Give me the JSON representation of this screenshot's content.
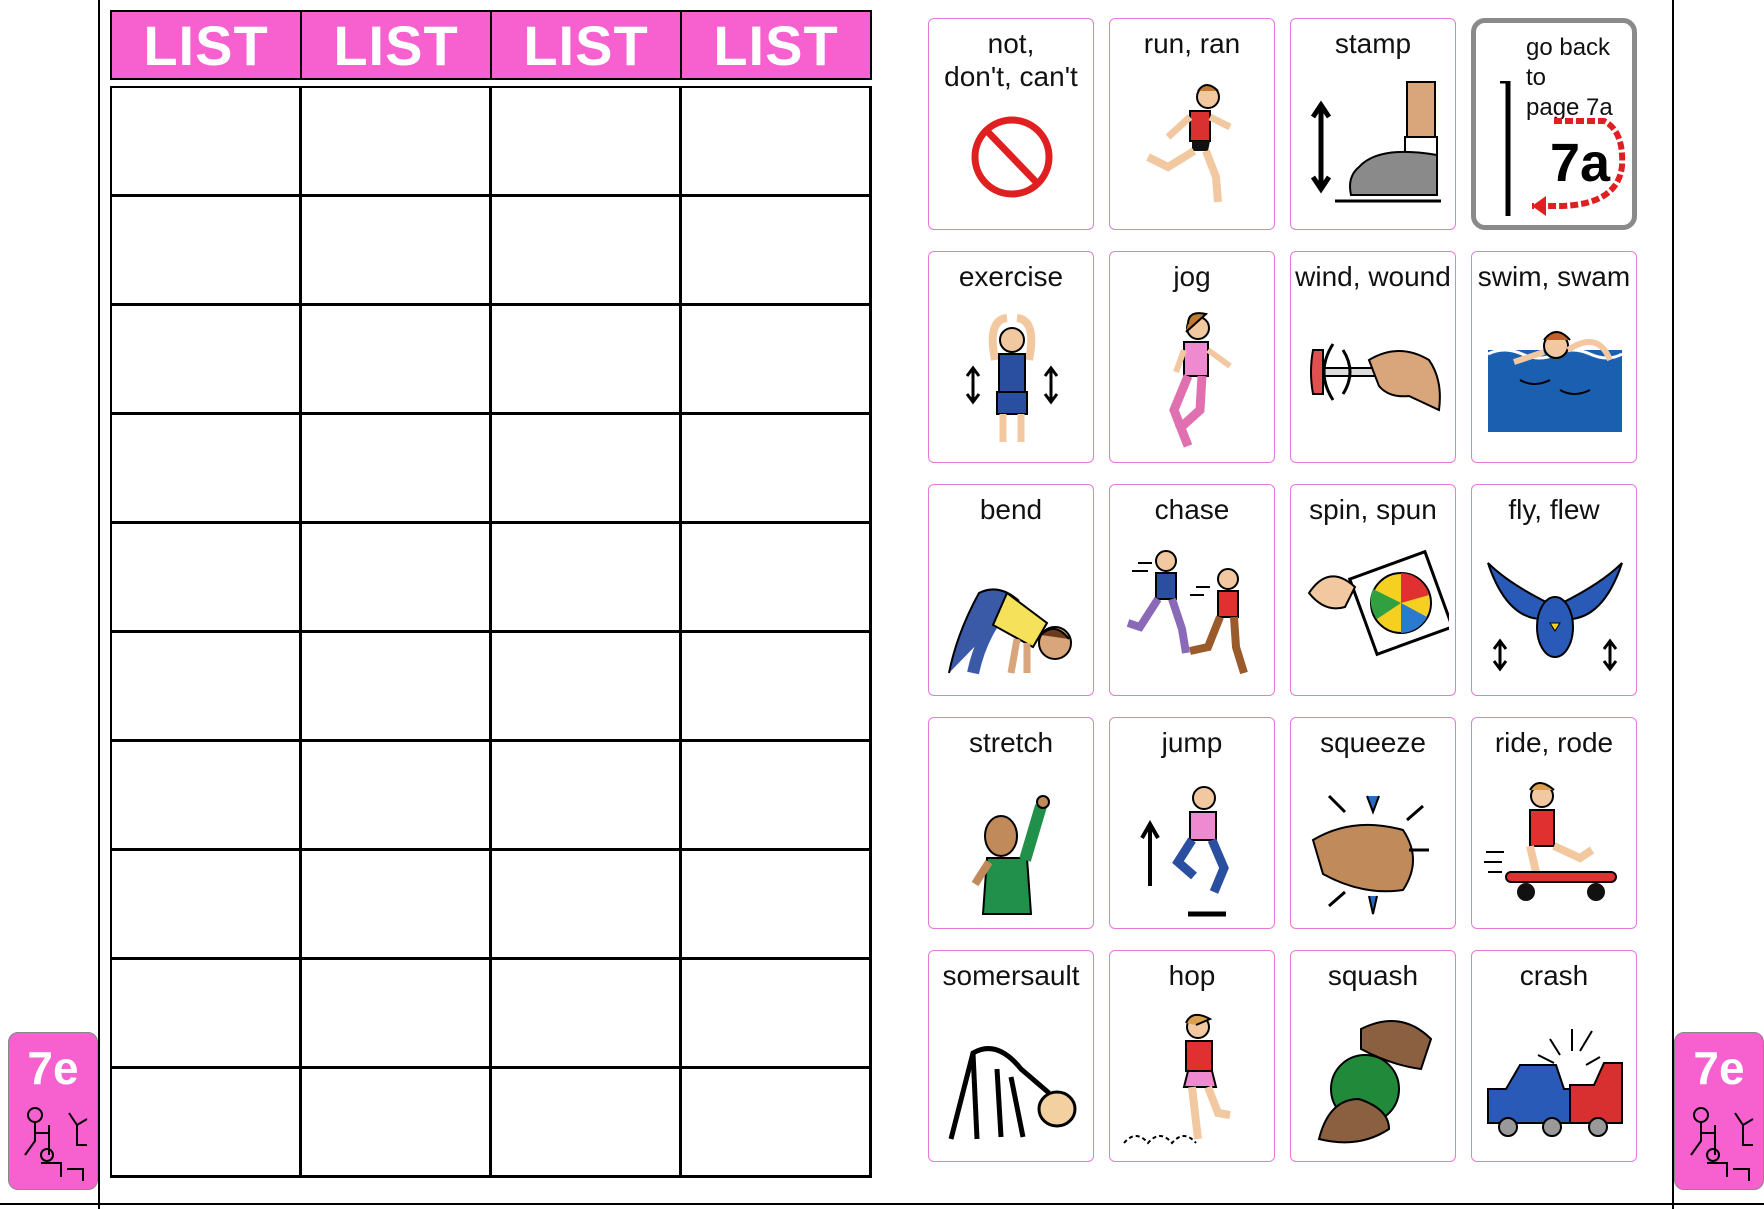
{
  "list_header": [
    "LIST",
    "LIST",
    "LIST",
    "LIST"
  ],
  "list_rows": 10,
  "tiles": [
    {
      "label": "not,\ndon't, can't",
      "icon": "prohibited-icon"
    },
    {
      "label": "run,  ran",
      "icon": "running-girl-icon"
    },
    {
      "label": "stamp",
      "icon": "stamping-foot-icon"
    },
    {
      "label": "go back to\npage 7a",
      "icon": "go-back-page-7a-icon",
      "sub": "7a"
    },
    {
      "label": "exercise",
      "icon": "exercise-icon"
    },
    {
      "label": "jog",
      "icon": "jogging-girl-icon"
    },
    {
      "label": "wind,  wound",
      "icon": "wind-key-icon"
    },
    {
      "label": "swim,  swam",
      "icon": "swimmer-icon"
    },
    {
      "label": "bend",
      "icon": "bending-man-icon"
    },
    {
      "label": "chase",
      "icon": "chasing-kids-icon"
    },
    {
      "label": "spin,  spun",
      "icon": "spinner-icon"
    },
    {
      "label": "fly,  flew",
      "icon": "flying-bird-icon"
    },
    {
      "label": "stretch",
      "icon": "stretching-person-icon"
    },
    {
      "label": "jump",
      "icon": "jumping-girl-icon"
    },
    {
      "label": "squeeze",
      "icon": "squeezing-hand-icon"
    },
    {
      "label": "ride,  rode",
      "icon": "skateboard-rider-icon"
    },
    {
      "label": "somersault",
      "icon": "somersault-icon"
    },
    {
      "label": "hop",
      "icon": "hopping-girl-icon"
    },
    {
      "label": "squash",
      "icon": "squashing-hands-icon"
    },
    {
      "label": "crash",
      "icon": "car-crash-icon"
    }
  ],
  "page_tab": "7e",
  "colors": {
    "tab_pink": "#f661cf",
    "tile_border": "#e57ad8"
  }
}
